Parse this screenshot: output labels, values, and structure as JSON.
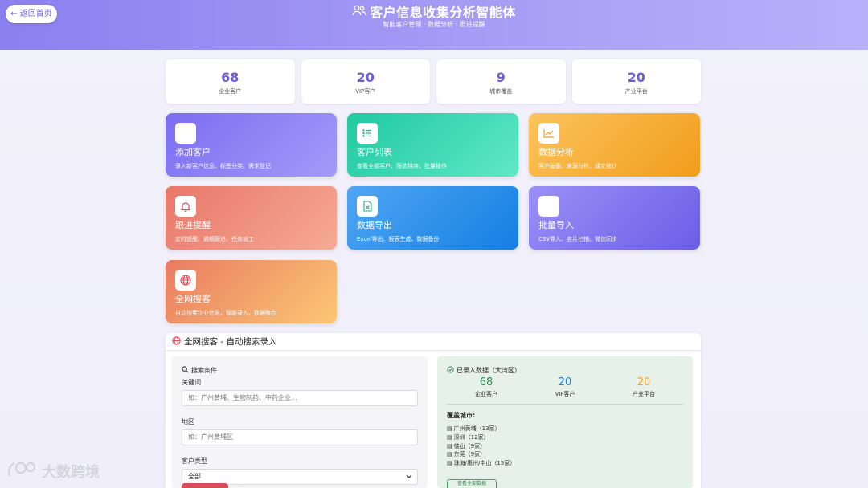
{
  "header": {
    "back_label": "← 返回首页",
    "title": "客户信息收集分析智能体",
    "subtitle": "智能客户管理 · 数据分析 · 跟进提醒"
  },
  "stats": [
    {
      "value": "68",
      "label": "企业客户"
    },
    {
      "value": "20",
      "label": "VIP客户"
    },
    {
      "value": "9",
      "label": "城市覆盖"
    },
    {
      "value": "20",
      "label": "产业平台"
    }
  ],
  "cards": [
    {
      "title": "添加客户",
      "desc": "录入新客户信息、标签分类、需求登记",
      "icon": "user-plus-icon"
    },
    {
      "title": "客户列表",
      "desc": "查看全部客户、筛选排序、批量操作",
      "icon": "list-icon"
    },
    {
      "title": "数据分析",
      "desc": "客户画像、来源分析、成交统计",
      "icon": "chart-icon"
    },
    {
      "title": "跟进提醒",
      "desc": "定时提醒、逾期跟进、任务派工",
      "icon": "bell-icon"
    },
    {
      "title": "数据导出",
      "desc": "Excel导出、报表生成、数据备份",
      "icon": "excel-file-icon"
    },
    {
      "title": "批量导入",
      "desc": "CSV导入、名片扫描、微信同步",
      "icon": "import-icon"
    },
    {
      "title": "全网搜客",
      "desc": "自动搜索企业信息、智能录入、数据整合",
      "icon": "globe-icon"
    }
  ],
  "panel": {
    "title": "全网搜客 - 自动搜索录入",
    "search": {
      "section_label": "搜索条件",
      "keyword_label": "关键词",
      "keyword_placeholder": "如：广州黄埔、生物制药、中药企业...",
      "region_label": "地区",
      "region_placeholder": "如：广州黄埔区",
      "type_label": "客户类型",
      "type_value": "全部"
    },
    "recorded": {
      "section_label": "已录入数据（大湾区）",
      "stats": [
        {
          "value": "68",
          "label": "企业客户",
          "color": "#2e8a50"
        },
        {
          "value": "20",
          "label": "VIP客户",
          "color": "#1a7fd6"
        },
        {
          "value": "20",
          "label": "产业平台",
          "color": "#f0a020"
        }
      ],
      "coverage_title": "覆盖城市:",
      "cities": [
        "广州黄埔（13家）",
        "深圳（12家）",
        "佛山（9家）",
        "东莞（9家）",
        "珠海/惠州/中山（15家）"
      ],
      "view_button": "查看全部数据"
    }
  },
  "watermark": "大数跨境"
}
